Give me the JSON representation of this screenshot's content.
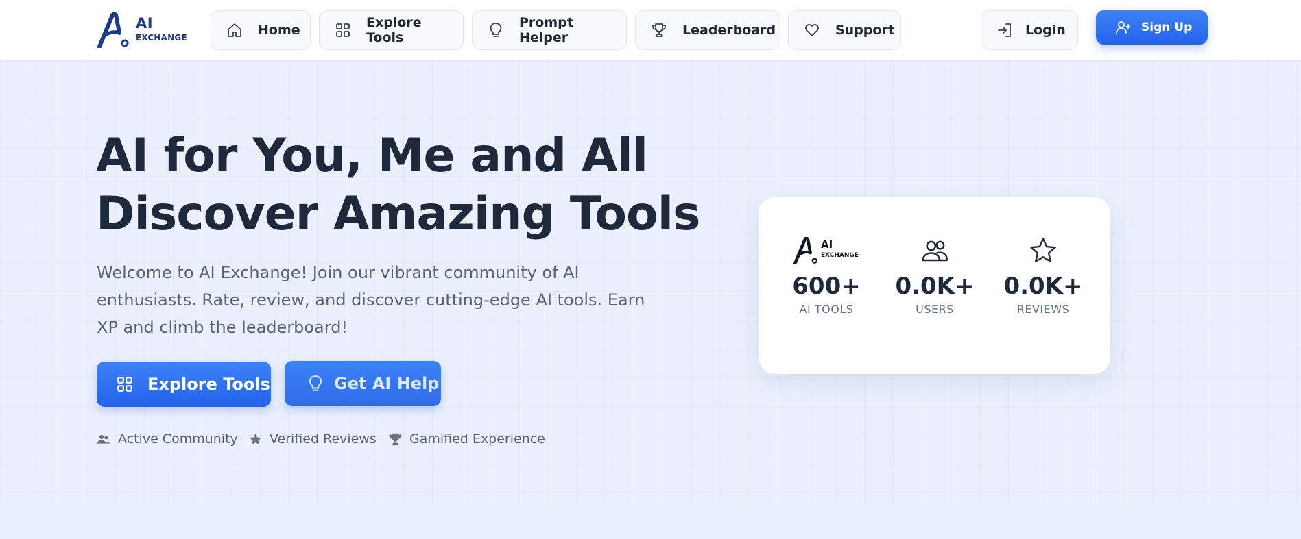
{
  "brand": {
    "ai": "AI",
    "exchange": "EXCHANGE",
    "color": "#1e3a8a"
  },
  "nav": {
    "items": [
      {
        "label": "Home",
        "icon": "home-icon"
      },
      {
        "label": "Explore Tools",
        "icon": "grid-icon"
      },
      {
        "label": "Prompt Helper",
        "icon": "lightbulb-icon"
      },
      {
        "label": "Leaderboard",
        "icon": "trophy-icon"
      },
      {
        "label": "Support",
        "icon": "heart-icon"
      }
    ],
    "login": "Login",
    "signup": "Sign Up"
  },
  "hero": {
    "title_line1": "AI for You, Me and All",
    "title_line2": "Discover Amazing Tools",
    "description": "Welcome to AI Exchange! Join our vibrant community of AI enthusiasts. Rate, review, and discover cutting-edge AI tools. Earn XP and climb the leaderboard!",
    "explore_label": "Explore Tools",
    "help_label": "Get AI Help",
    "features": [
      {
        "label": "Active Community",
        "icon": "users-icon"
      },
      {
        "label": "Verified Reviews",
        "icon": "star-icon"
      },
      {
        "label": "Gamified Experience",
        "icon": "trophy-icon"
      }
    ]
  },
  "stats": [
    {
      "value": "600+",
      "label": "AI TOOLS",
      "icon": "ai-exchange-logo-icon"
    },
    {
      "value": "0.0K+",
      "label": "USERS",
      "icon": "users-icon"
    },
    {
      "value": "0.0K+",
      "label": "REVIEWS",
      "icon": "star-icon"
    }
  ],
  "colors": {
    "primary": "#2563eb",
    "primary_light": "#3b82f6",
    "text_dark": "#1e293b",
    "text_muted": "#5b6472"
  }
}
